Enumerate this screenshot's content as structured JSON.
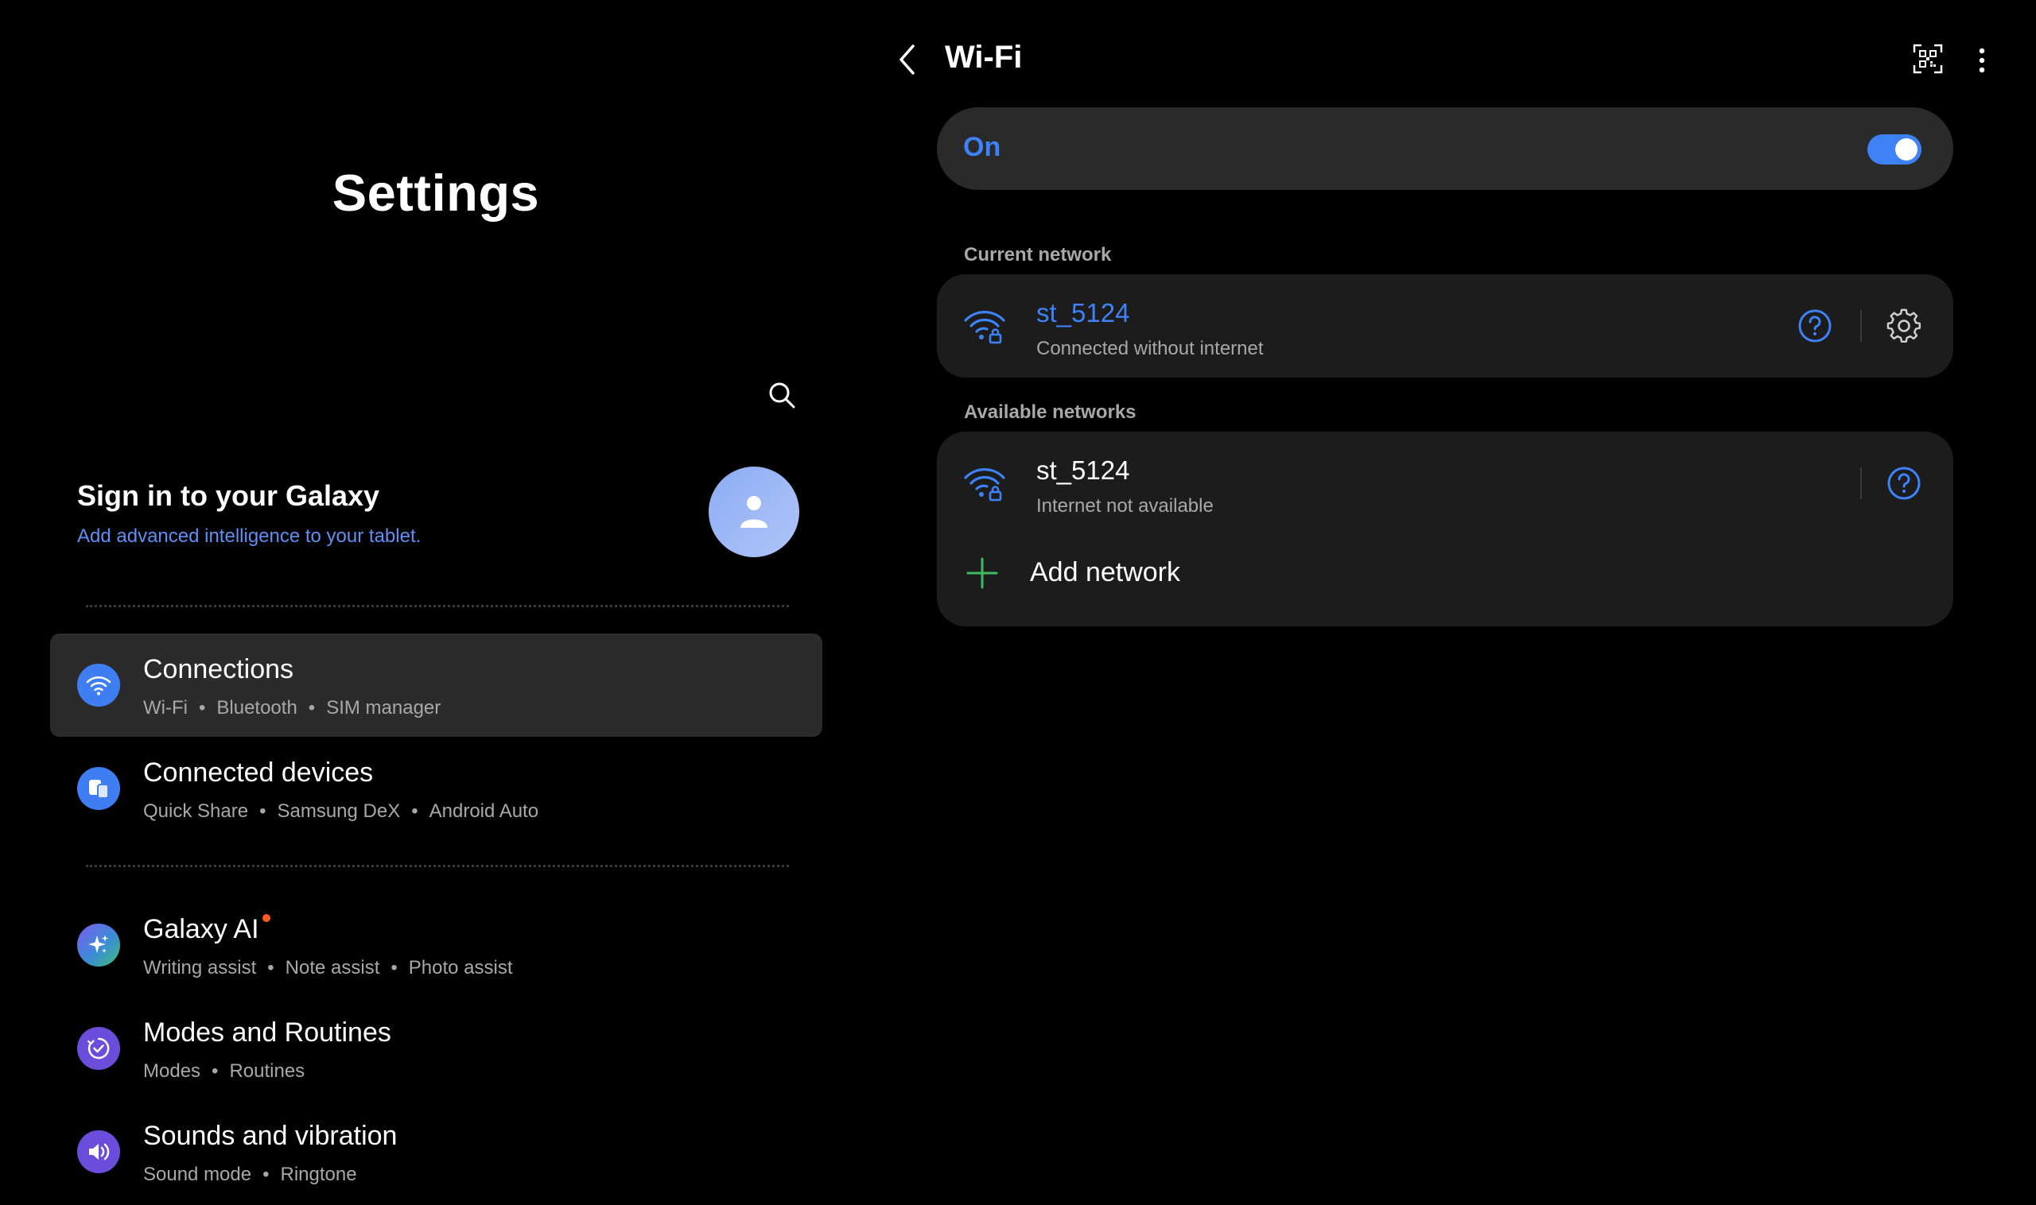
{
  "left": {
    "title": "Settings",
    "account": {
      "title": "Sign in to your Galaxy",
      "subtitle": "Add advanced intelligence to your tablet."
    },
    "menu": [
      {
        "title": "Connections",
        "sub": [
          "Wi-Fi",
          "Bluetooth",
          "SIM manager"
        ],
        "icon": "wifi-icon",
        "color": "#3e7ef2",
        "selected": true
      },
      {
        "title": "Connected devices",
        "sub": [
          "Quick Share",
          "Samsung DeX",
          "Android Auto"
        ],
        "icon": "devices-icon",
        "color": "#3e7ef2"
      },
      {
        "title": "Galaxy AI",
        "sub": [
          "Writing assist",
          "Note assist",
          "Photo assist"
        ],
        "icon": "sparkle-icon",
        "color": "#3b8bd6"
      },
      {
        "title": "Modes and Routines",
        "sub": [
          "Modes",
          "Routines"
        ],
        "icon": "check-circle-icon",
        "color": "#6a4ddb"
      },
      {
        "title": "Sounds and vibration",
        "sub": [
          "Sound mode",
          "Ringtone"
        ],
        "icon": "speaker-icon",
        "color": "#6a4ddb"
      }
    ]
  },
  "right": {
    "title": "Wi-Fi",
    "toggle": {
      "label": "On",
      "state": true
    },
    "current_label": "Current network",
    "current": {
      "name": "st_5124",
      "status": "Connected without internet"
    },
    "available_label": "Available networks",
    "available": [
      {
        "name": "st_5124",
        "status": "Internet not available"
      }
    ],
    "add_label": "Add network"
  },
  "colors": {
    "accent": "#3e82f7",
    "link": "#5f8ff5",
    "add": "#3dbb5f",
    "badge": "#ff5a1f"
  }
}
